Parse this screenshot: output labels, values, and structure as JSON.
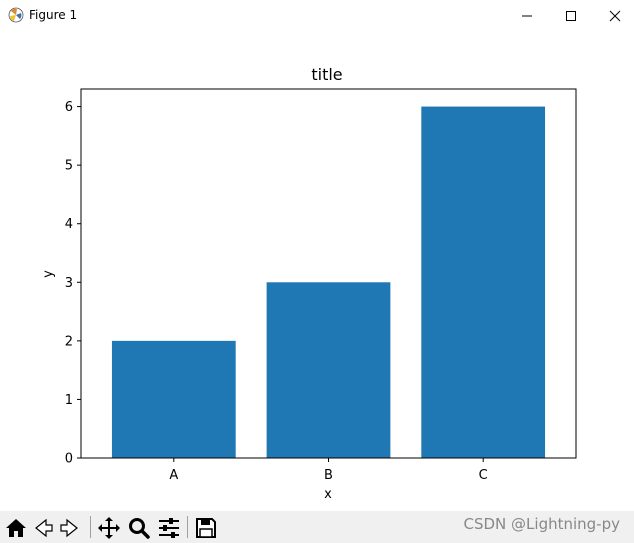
{
  "window": {
    "title": "Figure 1",
    "icons": {
      "app": "matplotlib-icon",
      "minimize": "minimize-icon",
      "maximize": "maximize-icon",
      "close": "close-icon"
    }
  },
  "chart_data": {
    "type": "bar",
    "title": "title",
    "xlabel": "x",
    "ylabel": "y",
    "categories": [
      "A",
      "B",
      "C"
    ],
    "values": [
      2,
      3,
      6
    ],
    "ylim": [
      0,
      6.3
    ],
    "yticks": [
      "0",
      "1",
      "2",
      "3",
      "4",
      "5",
      "6"
    ],
    "grid": false,
    "bar_color": "#1f77b4"
  },
  "toolbar": {
    "icons": [
      "home-icon",
      "back-icon",
      "forward-icon",
      "pan-icon",
      "zoom-icon",
      "configure-subplots-icon",
      "save-icon"
    ],
    "watermark": "CSDN @Lightning-py"
  }
}
